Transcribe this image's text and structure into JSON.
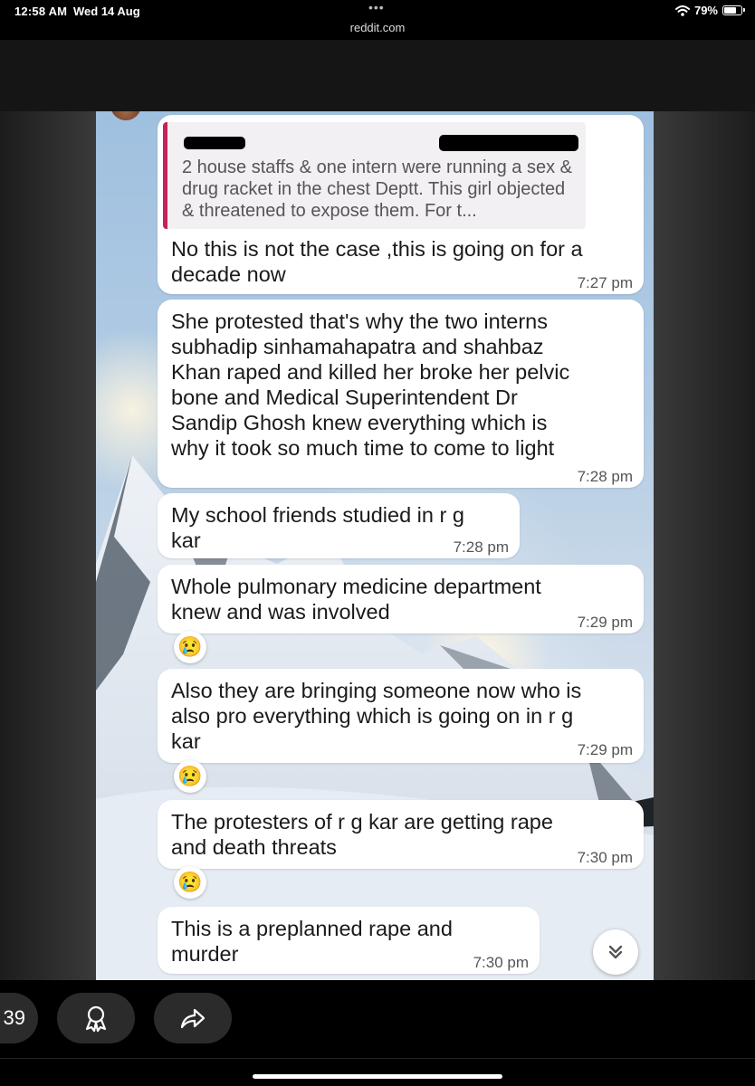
{
  "status_bar": {
    "time": "12:58 AM",
    "date": "Wed 14 Aug",
    "dots": "•••",
    "url": "reddit.com",
    "battery": "79%",
    "battery_level": 0.79
  },
  "chat": {
    "quote_text": "2 house staffs  & one intern were running a sex & drug racket in the chest Deptt. This girl objected & threatened to expose them. For t...",
    "messages": [
      {
        "text": "No this is not the case ,this is going on for a decade now",
        "time": "7:27 pm"
      },
      {
        "text": "She protested that's why the two interns subhadip sinhamahapatra and shahbaz Khan raped and killed her broke her pelvic bone and Medical Superintendent Dr Sandip Ghosh knew everything which is why it took so much time to come to light",
        "time": "7:28 pm"
      },
      {
        "text": "My school friends studied in r g kar",
        "time": "7:28 pm"
      },
      {
        "text": "Whole pulmonary medicine department knew and was involved",
        "time": "7:29 pm",
        "reaction": "😢"
      },
      {
        "text": "Also they are bringing someone now who is also pro everything which is going on in r g kar",
        "time": "7:29 pm",
        "reaction": "😢"
      },
      {
        "text": "The protesters of r g kar are getting rape and death threats",
        "time": "7:30 pm",
        "reaction": "😢"
      },
      {
        "text": "This is a preplanned rape and murder",
        "time": "7:30 pm"
      }
    ],
    "scroll_down_icon": "double-chevron-down-icon"
  },
  "bottom_bar": {
    "award_count": "39",
    "award_icon": "award-ribbon-icon",
    "share_icon": "share-arrow-icon"
  }
}
